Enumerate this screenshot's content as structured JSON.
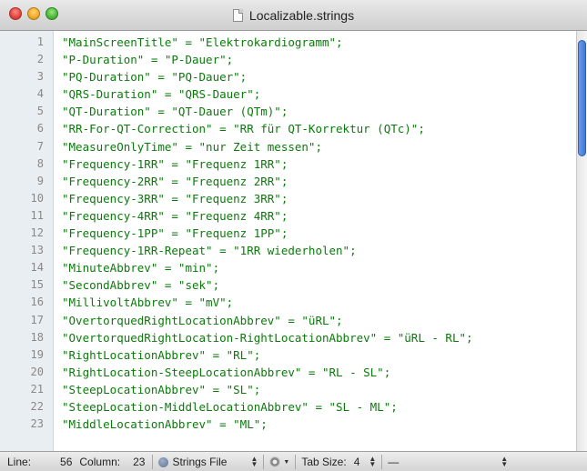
{
  "window": {
    "title": "Localizable.strings"
  },
  "editor": {
    "line_numbers": [
      "1",
      "2",
      "3",
      "4",
      "5",
      "6",
      "7",
      "8",
      "9",
      "10",
      "11",
      "12",
      "13",
      "14",
      "15",
      "16",
      "17",
      "18",
      "19",
      "20",
      "21",
      "22",
      "23"
    ],
    "lines": [
      "\"MainScreenTitle\" = \"Elektrokardiogramm\";",
      "\"P-Duration\" = \"P-Dauer\";",
      "\"PQ-Duration\" = \"PQ-Dauer\";",
      "\"QRS-Duration\" = \"QRS-Dauer\";",
      "\"QT-Duration\" = \"QT-Dauer (QTm)\";",
      "\"RR-For-QT-Correction\" = \"RR für QT-Korrektur (QTc)\";",
      "\"MeasureOnlyTime\" = \"nur Zeit messen\";",
      "\"Frequency-1RR\" = \"Frequenz 1RR\";",
      "\"Frequency-2RR\" = \"Frequenz 2RR\";",
      "\"Frequency-3RR\" = \"Frequenz 3RR\";",
      "\"Frequency-4RR\" = \"Frequenz 4RR\";",
      "\"Frequency-1PP\" = \"Frequenz 1PP\";",
      "\"Frequency-1RR-Repeat\" = \"1RR wiederholen\";",
      "\"MinuteAbbrev\" = \"min\";",
      "\"SecondAbbrev\" = \"sek\";",
      "\"MillivoltAbbrev\" = \"mV\";",
      "\"OvertorquedRightLocationAbbrev\" = \"üRL\";",
      "\"OvertorquedRightLocation-RightLocationAbbrev\" = \"üRL - RL\";",
      "\"RightLocationAbbrev\" = \"RL\";",
      "\"RightLocation-SteepLocationAbbrev\" = \"RL - SL\";",
      "\"SteepLocationAbbrev\" = \"SL\";",
      "\"SteepLocation-MiddleLocationAbbrev\" = \"SL - ML\";",
      "\"MiddleLocationAbbrev\" = \"ML\";"
    ],
    "text_color": "#0b7a0b"
  },
  "statusbar": {
    "line_label": "Line:",
    "line_value": "56",
    "column_label": "Column:",
    "column_value": "23",
    "file_type": "Strings File",
    "tab_size_label": "Tab Size:",
    "tab_size_value": "4",
    "function_value": "—"
  },
  "colors": {
    "scroll_thumb": "#3f78d8",
    "gutter_bg": "#e9eef3"
  }
}
